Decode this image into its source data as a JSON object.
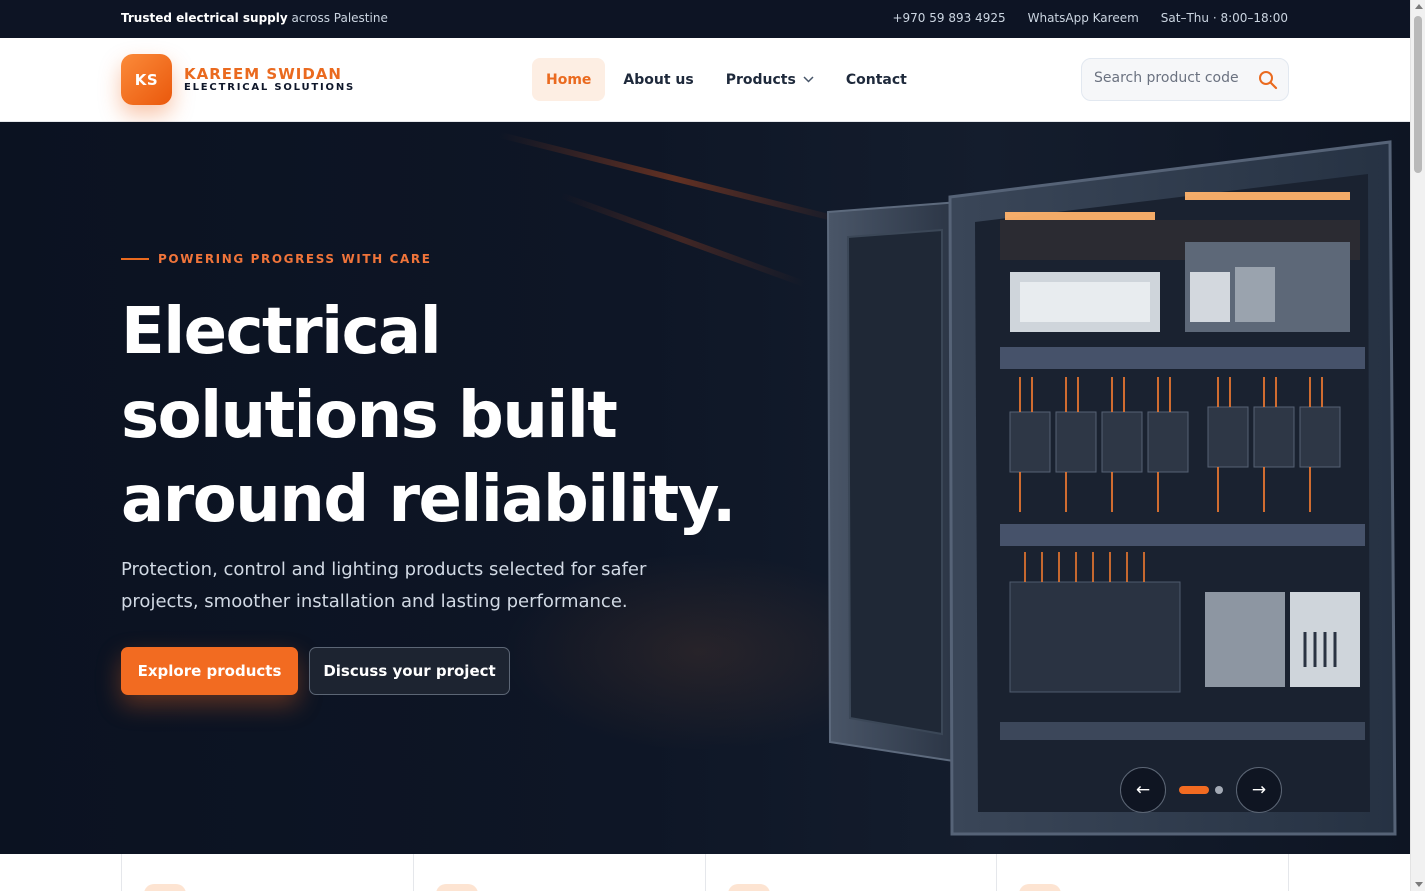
{
  "topbar": {
    "tagline_bold": "Trusted electrical supply",
    "tagline_rest": " across Palestine",
    "phone": "+970 59 893 4925",
    "whatsapp": "WhatsApp Kareem",
    "hours": "Sat–Thu · 8:00–18:00"
  },
  "brand": {
    "initials": "KS",
    "name": "KAREEM SWIDAN",
    "subtitle": "ELECTRICAL SOLUTIONS",
    "accent_color": "#f26b21"
  },
  "nav": {
    "items": [
      {
        "label": "Home",
        "active": true
      },
      {
        "label": "About us"
      },
      {
        "label": "Products",
        "has_dropdown": true
      },
      {
        "label": "Contact"
      }
    ]
  },
  "search": {
    "placeholder": "Search product code",
    "icon": "search-icon"
  },
  "hero": {
    "eyebrow": "POWERING PROGRESS WITH CARE",
    "title": "Electrical solutions built around reliability.",
    "description": "Protection, control and lighting products selected for safer projects, smoother installation and lasting performance.",
    "primary_cta": "Explore products",
    "secondary_cta": "Discuss your project",
    "slider": {
      "prev": "←",
      "next": "→",
      "slide_count": 2,
      "active_slide": 1
    }
  }
}
